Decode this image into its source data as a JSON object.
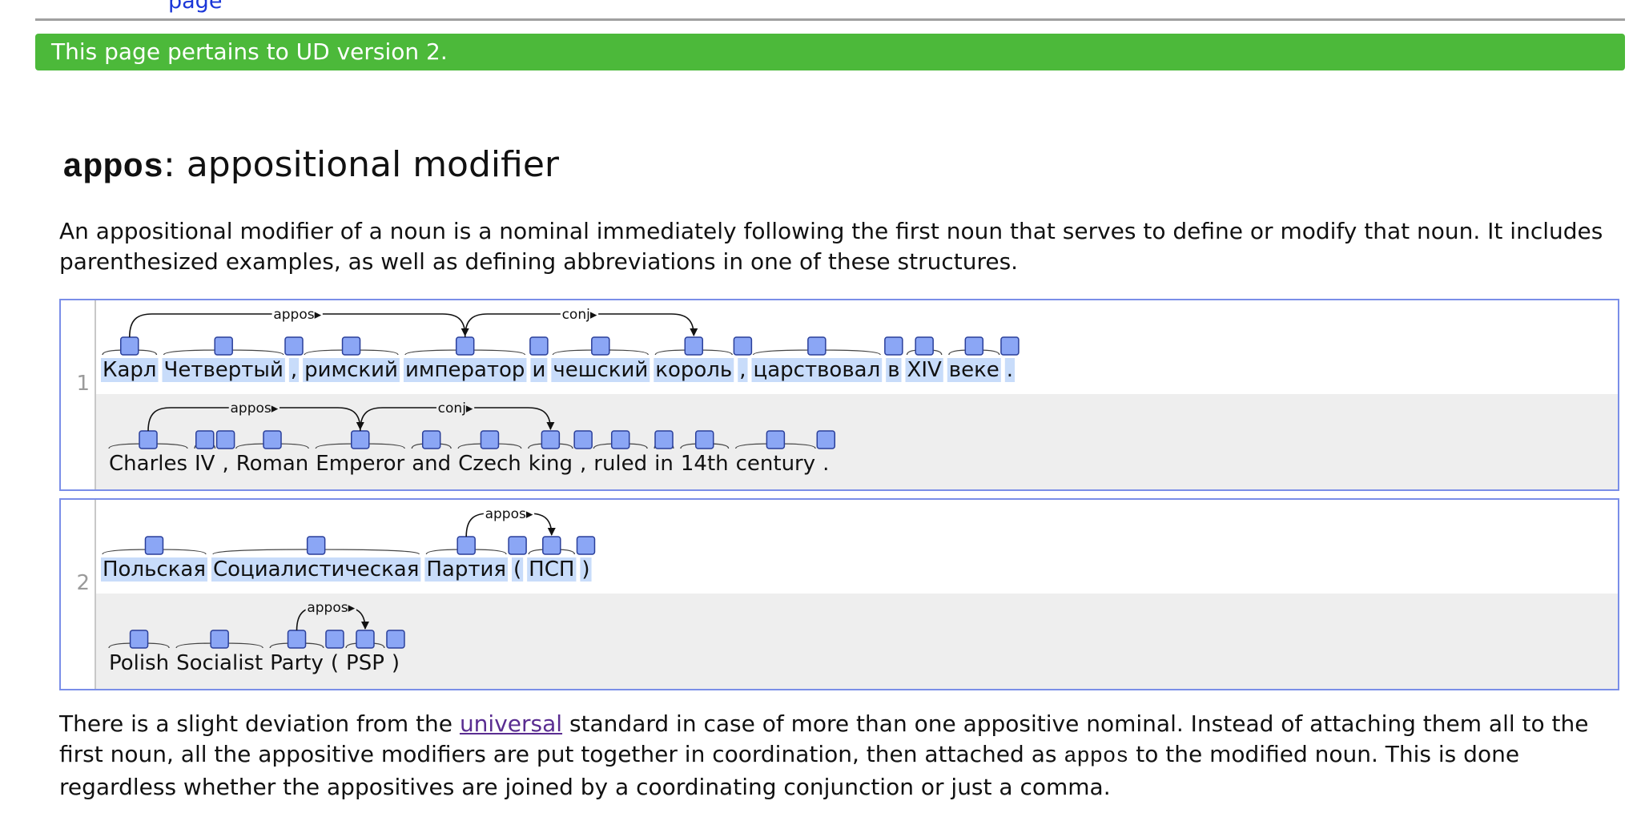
{
  "page": {
    "top_link": "page",
    "banner": "This page pertains to UD version 2.",
    "title_code": "appos",
    "title_text": ": appositional modifier",
    "intro": "An appositional modifier of a noun is a nominal immediately following the first noun that serves to define or modify that noun. It includes parenthesized examples, as well as defining abbreviations in one of these structures.",
    "footer": {
      "before_link": "There is a slight deviation from the ",
      "link": "universal",
      "middle": " standard in case of more than one appositive nominal. Instead of attaching them all to the first noun, all the appositive modifiers are put together in coordination, then attached as ",
      "code": "appos",
      "after": " to the modified noun. This is done regardless whether the appositives are joined by a coordinating conjunction or just a comma."
    }
  },
  "examples": [
    {
      "number": "1",
      "original": {
        "tokens": [
          "Карл",
          "Четвертый",
          ",",
          "римский",
          "император",
          "и",
          "чешский",
          "король",
          ",",
          "царствовал",
          "в",
          "XIV",
          "веке",
          "."
        ],
        "arcs": [
          {
            "from": 0,
            "to": 4,
            "label": "appos"
          },
          {
            "from": 4,
            "to": 7,
            "label": "conj"
          }
        ]
      },
      "translation": {
        "tokens": [
          "Charles",
          "IV",
          ",",
          "Roman",
          "Emperor",
          "and",
          "Czech",
          "king",
          ",",
          "ruled",
          "in",
          "14th",
          "century",
          "."
        ],
        "arcs": [
          {
            "from": 0,
            "to": 4,
            "label": "appos"
          },
          {
            "from": 4,
            "to": 7,
            "label": "conj"
          }
        ]
      }
    },
    {
      "number": "2",
      "original": {
        "tokens": [
          "Польская",
          "Социалистическая",
          "Партия",
          "(",
          "ПСП",
          ")"
        ],
        "arcs": [
          {
            "from": 2,
            "to": 4,
            "label": "appos"
          }
        ]
      },
      "translation": {
        "tokens": [
          "Polish",
          "Socialist",
          "Party",
          "(",
          "PSP",
          ")"
        ],
        "arcs": [
          {
            "from": 2,
            "to": 4,
            "label": "appos"
          }
        ]
      }
    }
  ]
}
